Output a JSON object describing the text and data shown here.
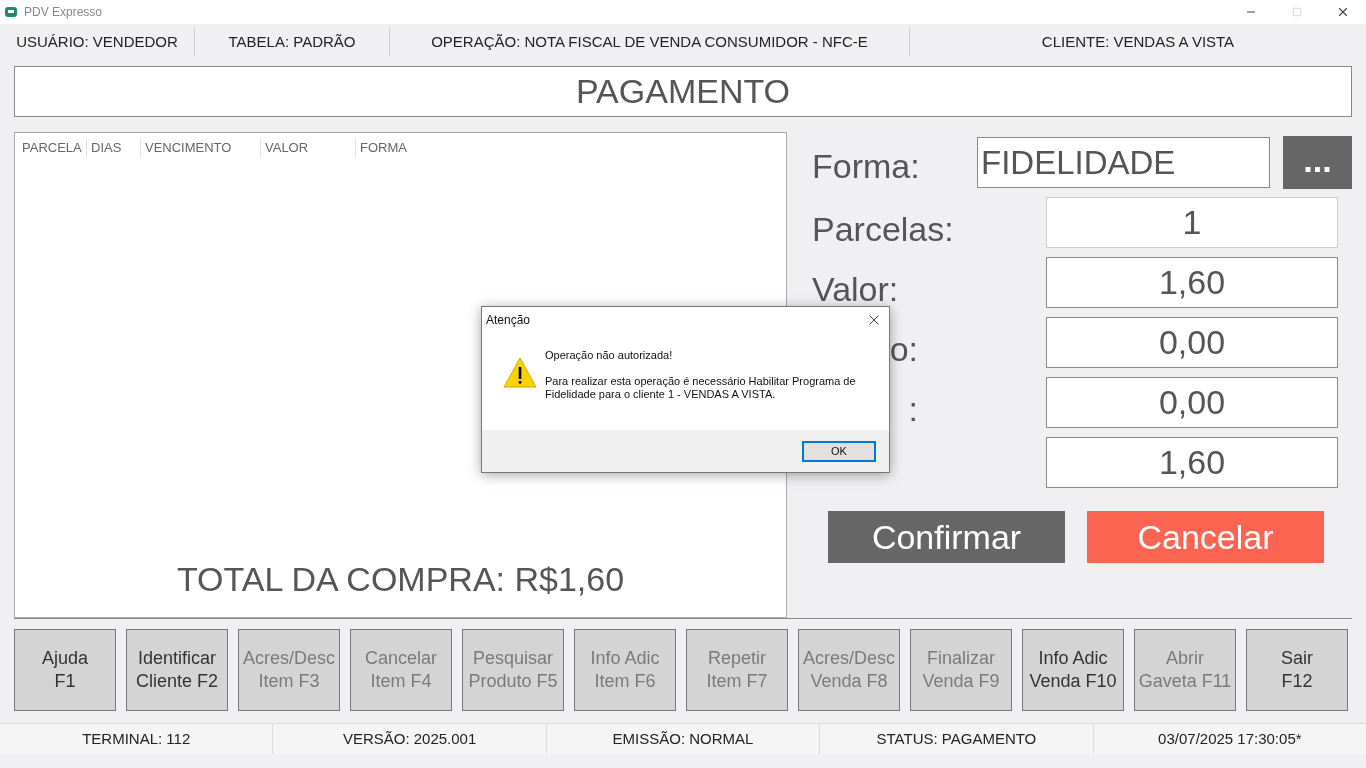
{
  "window": {
    "title": "PDV Expresso"
  },
  "info_bar": [
    "USUÁRIO: VENDEDOR",
    "TABELA: PADRÃO",
    "OPERAÇÃO: NOTA FISCAL DE VENDA CONSUMIDOR - NFC-E",
    "CLIENTE: VENDAS A VISTA"
  ],
  "heading": "PAGAMENTO",
  "table": {
    "columns": [
      "PARCELA",
      "DIAS",
      "VENCIMENTO",
      "VALOR",
      "FORMA"
    ]
  },
  "total": "TOTAL DA COMPRA: R$1,60",
  "form": {
    "forma": {
      "label": "Forma:",
      "value": "FIDELIDADE",
      "button": "..."
    },
    "rows": [
      {
        "label": "Parcelas:",
        "value": "1",
        "kind": "full"
      },
      {
        "label": "Valor:",
        "value": "1,60",
        "kind": "full"
      },
      {
        "label": "o:",
        "value": "0,00",
        "kind": "cut"
      },
      {
        "label": ":",
        "value": "0,00",
        "kind": "cut"
      },
      {
        "value": "1,60",
        "kind": "hidden"
      }
    ]
  },
  "actions": [
    {
      "label": "Confirmar",
      "kind": "confirm"
    },
    {
      "label": "Cancelar",
      "kind": "cancel"
    }
  ],
  "function_keys": [
    {
      "label": "Ajuda",
      "key": "F1",
      "disabled": false
    },
    {
      "label": "Identificar",
      "key": "Cliente F2",
      "disabled": false
    },
    {
      "label": "Acres/Desc",
      "key": "Item F3",
      "disabled": true
    },
    {
      "label": "Cancelar",
      "key": "Item F4",
      "disabled": true
    },
    {
      "label": "Pesquisar",
      "key": "Produto F5",
      "disabled": true
    },
    {
      "label": "Info Adic",
      "key": "Item F6",
      "disabled": true
    },
    {
      "label": "Repetir",
      "key": "Item F7",
      "disabled": true
    },
    {
      "label": "Acres/Desc",
      "key": "Venda F8",
      "disabled": true
    },
    {
      "label": "Finalizar",
      "key": "Venda F9",
      "disabled": true
    },
    {
      "label": "Info Adic",
      "key": "Venda F10",
      "disabled": false
    },
    {
      "label": "Abrir",
      "key": "Gaveta F11",
      "disabled": true
    },
    {
      "label": "Sair",
      "key": "F12",
      "disabled": false
    }
  ],
  "status_bar": [
    "TERMINAL: 112",
    "VERSÃO: 2025.001",
    "EMISSÃO: NORMAL",
    "STATUS: PAGAMENTO",
    "03/07/2025 17:30:05*"
  ],
  "dialog": {
    "title": "Atenção",
    "heading": "Operação não autorizada!",
    "message": "Para realizar esta operação é necessário Habilitar Programa de Fidelidade para o cliente 1 - VENDAS A VISTA.",
    "button": "OK"
  }
}
